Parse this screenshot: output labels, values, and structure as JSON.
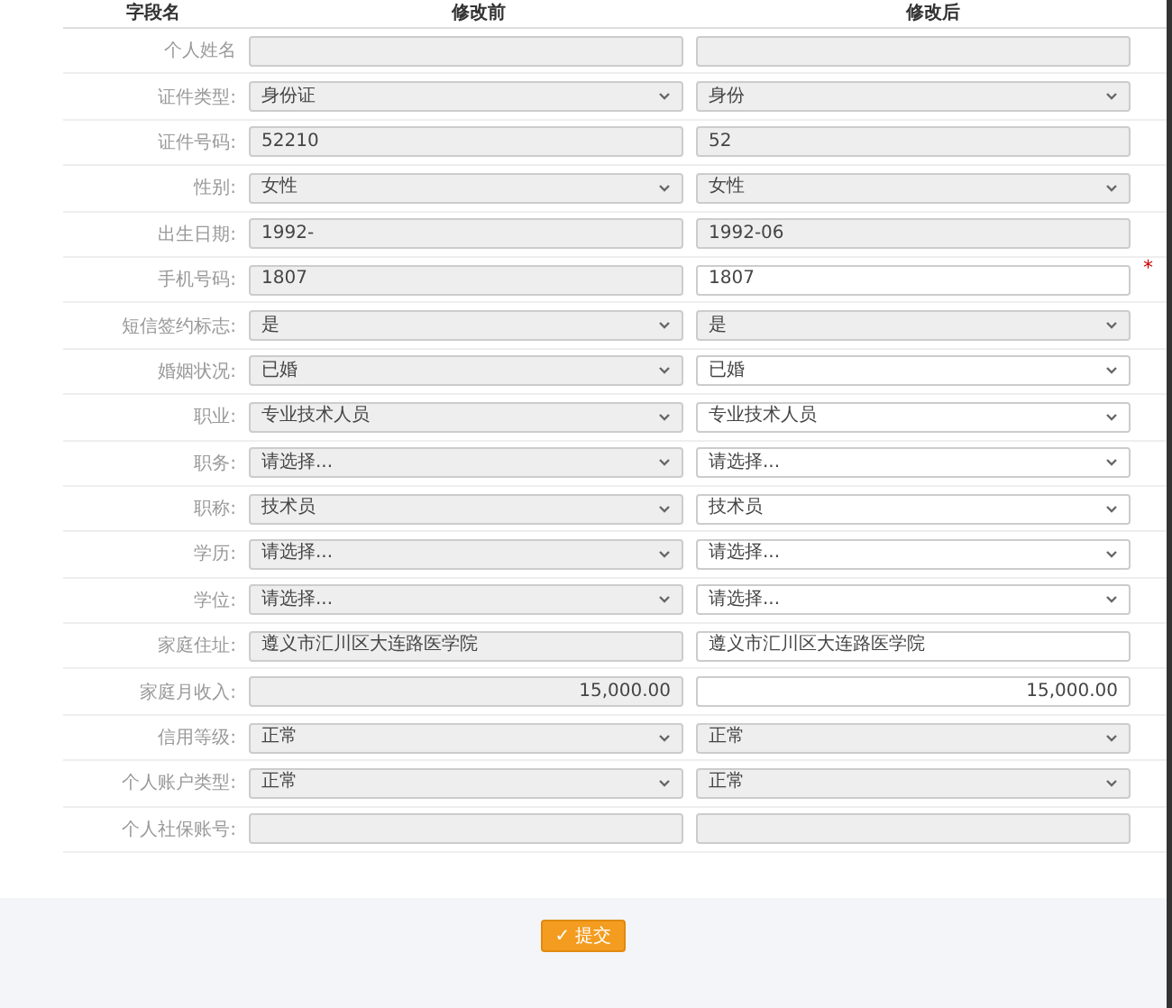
{
  "header": {
    "field_column": "字段名",
    "before_column": "修改前",
    "after_column": "修改后"
  },
  "rows": [
    {
      "label": "个人姓名",
      "before": {
        "kind": "input",
        "disabled": true
      },
      "after": {
        "kind": "input",
        "disabled": true
      }
    },
    {
      "label": "证件类型:",
      "before": {
        "kind": "select",
        "value": "身份证",
        "disabled": true
      },
      "after": {
        "kind": "select",
        "value": "身份",
        "disabled": true
      }
    },
    {
      "label": "证件号码:",
      "before": {
        "kind": "input",
        "value": "52210",
        "disabled": true
      },
      "after": {
        "kind": "input",
        "value": "52",
        "disabled": true
      }
    },
    {
      "label": "性别:",
      "before": {
        "kind": "select",
        "value": "女性",
        "disabled": true
      },
      "after": {
        "kind": "select",
        "value": "女性",
        "disabled": true
      }
    },
    {
      "label": "出生日期:",
      "before": {
        "kind": "input",
        "value": "1992-",
        "disabled": true
      },
      "after": {
        "kind": "input",
        "value": "1992-06",
        "disabled": true
      }
    },
    {
      "label": "手机号码:",
      "before": {
        "kind": "input",
        "value": "1807",
        "disabled": true
      },
      "after": {
        "kind": "input",
        "value": "1807",
        "disabled": false,
        "required_mark": "*"
      }
    },
    {
      "label": "短信签约标志:",
      "before": {
        "kind": "select",
        "value": "是",
        "disabled": true
      },
      "after": {
        "kind": "select",
        "value": "是",
        "disabled": true
      }
    },
    {
      "label": "婚姻状况:",
      "before": {
        "kind": "select",
        "value": "已婚",
        "disabled": true
      },
      "after": {
        "kind": "select",
        "value": "已婚",
        "disabled": false
      }
    },
    {
      "label": "职业:",
      "before": {
        "kind": "select",
        "value": "专业技术人员",
        "disabled": true
      },
      "after": {
        "kind": "select",
        "value": "专业技术人员",
        "disabled": false
      }
    },
    {
      "label": "职务:",
      "before": {
        "kind": "select",
        "value": "请选择...",
        "disabled": true
      },
      "after": {
        "kind": "select",
        "value": "请选择...",
        "disabled": false
      }
    },
    {
      "label": "职称:",
      "before": {
        "kind": "select",
        "value": "技术员",
        "disabled": true
      },
      "after": {
        "kind": "select",
        "value": "技术员",
        "disabled": false
      }
    },
    {
      "label": "学历:",
      "before": {
        "kind": "select",
        "value": "请选择...",
        "disabled": true
      },
      "after": {
        "kind": "select",
        "value": "请选择...",
        "disabled": false
      }
    },
    {
      "label": "学位:",
      "before": {
        "kind": "select",
        "value": "请选择...",
        "disabled": true
      },
      "after": {
        "kind": "select",
        "value": "请选择...",
        "disabled": false
      }
    },
    {
      "label": "家庭住址:",
      "before": {
        "kind": "input",
        "value": "遵义市汇川区大连路医学院",
        "disabled": true
      },
      "after": {
        "kind": "input",
        "value": "遵义市汇川区大连路医学院",
        "disabled": false
      }
    },
    {
      "label": "家庭月收入:",
      "before": {
        "kind": "number",
        "value": "15,000.00",
        "disabled": true
      },
      "after": {
        "kind": "number",
        "value": "15,000.00",
        "disabled": false
      }
    },
    {
      "label": "信用等级:",
      "before": {
        "kind": "select",
        "value": "正常",
        "disabled": true
      },
      "after": {
        "kind": "select",
        "value": "正常",
        "disabled": true
      }
    },
    {
      "label": "个人账户类型:",
      "before": {
        "kind": "select",
        "value": "正常",
        "disabled": true
      },
      "after": {
        "kind": "select",
        "value": "正常",
        "disabled": true
      }
    },
    {
      "label": "个人社保账号:",
      "before": {
        "kind": "input",
        "disabled": true
      },
      "after": {
        "kind": "input",
        "disabled": true
      }
    }
  ],
  "submit": {
    "icon": "✓",
    "label": "提交"
  }
}
